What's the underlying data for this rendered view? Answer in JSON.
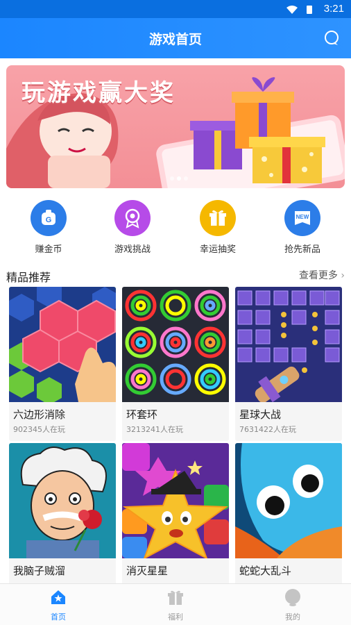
{
  "status_bar": {
    "time": "3:21"
  },
  "header": {
    "title": "游戏首页",
    "chat_icon": "chat-bubble-icon"
  },
  "banner": {
    "headline": "玩游戏赢大奖"
  },
  "quick_actions": [
    {
      "label": "赚金币",
      "icon": "coin-bag-icon",
      "color": "#2c7de8"
    },
    {
      "label": "游戏挑战",
      "icon": "medal-icon",
      "color": "#b64be8"
    },
    {
      "label": "幸运抽奖",
      "icon": "gift-icon",
      "color": "#f5b800"
    },
    {
      "label": "抢先新品",
      "icon": "new-tag-icon",
      "color": "#2c7de8"
    }
  ],
  "featured": {
    "title": "精品推荐",
    "more": "查看更多"
  },
  "games": [
    {
      "name": "六边形消除",
      "players": "902345人在玩"
    },
    {
      "name": "环套环",
      "players": "3213241人在玩"
    },
    {
      "name": "星球大战",
      "players": "7631422人在玩"
    },
    {
      "name": "我脑子贼溜",
      "players": ""
    },
    {
      "name": "消灭星星",
      "players": ""
    },
    {
      "name": "蛇蛇大乱斗",
      "players": ""
    }
  ],
  "tabs": [
    {
      "label": "首页",
      "icon": "home-icon",
      "active": true
    },
    {
      "label": "福利",
      "icon": "gift-icon",
      "active": false
    },
    {
      "label": "我的",
      "icon": "profile-icon",
      "active": false
    }
  ],
  "colors": {
    "primary": "#1b86ff",
    "tab_active": "#1b86ff",
    "tab_inactive": "#b9b9b9"
  }
}
